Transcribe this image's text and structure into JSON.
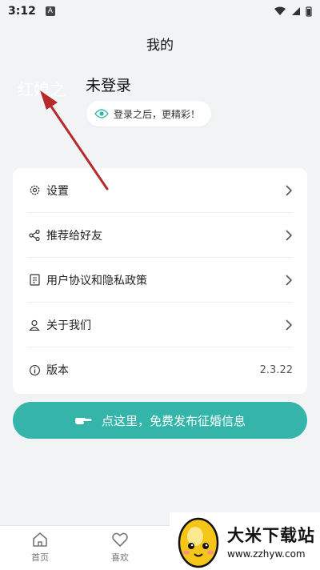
{
  "status_bar": {
    "time": "3:12",
    "notif_letter": "A"
  },
  "header": {
    "title": "我的"
  },
  "profile": {
    "avatar_text": "红娘之",
    "username": "未登录",
    "login_tip": "登录之后，更精彩！"
  },
  "menu": {
    "items": [
      {
        "label": "设置",
        "icon": "gear-icon"
      },
      {
        "label": "推荐给好友",
        "icon": "share-icon"
      },
      {
        "label": "用户协议和隐私政策",
        "icon": "document-icon"
      },
      {
        "label": "关于我们",
        "icon": "user-icon"
      },
      {
        "label": "版本",
        "icon": "info-icon",
        "value": "2.3.22"
      }
    ]
  },
  "publish": {
    "label": "点这里，免费发布征婚信息",
    "icon": "pointing-hand-icon"
  },
  "bottom_nav": {
    "items": [
      {
        "label": "首页",
        "icon": "home-icon"
      },
      {
        "label": "喜欢",
        "icon": "heart-icon"
      }
    ]
  },
  "watermark": {
    "title": "大米下载站",
    "url": "www.zzhyw.com"
  },
  "colors": {
    "accent": "#35b5a9",
    "background": "#f2f3f5",
    "arrow": "#b52a2a"
  }
}
